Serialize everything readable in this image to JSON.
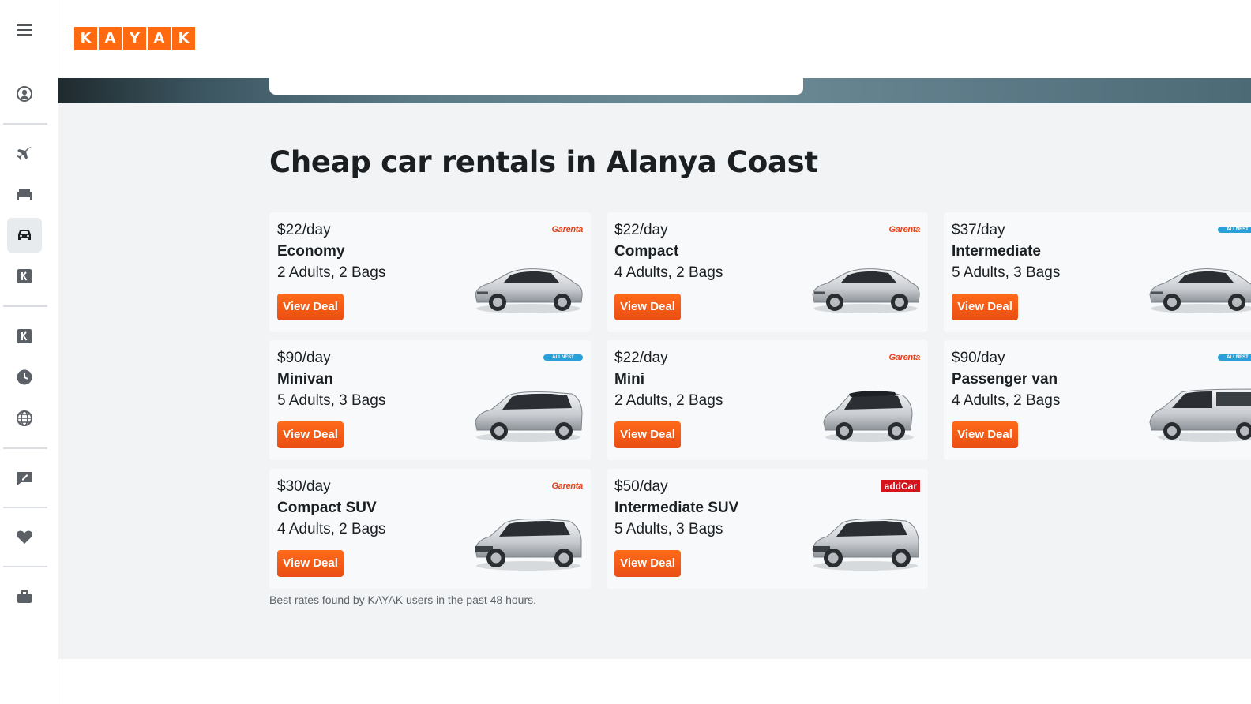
{
  "header": {
    "logo_letters": [
      "K",
      "A",
      "Y",
      "A",
      "K"
    ]
  },
  "sidebar": {
    "icons": [
      "menu-icon",
      "account-icon",
      "flights-icon",
      "stays-icon",
      "cars-icon",
      "packages-icon",
      "explore-icon",
      "trips-icon",
      "globe-icon",
      "feedback-icon",
      "heart-icon",
      "briefcase-icon"
    ]
  },
  "main": {
    "title": "Cheap car rentals in Alanya Coast",
    "deal_label": "View Deal",
    "footnote": "Best rates found by KAYAK users in the past 48 hours.",
    "cards": [
      {
        "price": "$22/day",
        "type": "Economy",
        "capacity": "2 Adults, 2 Bags",
        "brand": "Garenta",
        "car": "sedan"
      },
      {
        "price": "$22/day",
        "type": "Compact",
        "capacity": "4 Adults, 2 Bags",
        "brand": "Garenta",
        "car": "sedan"
      },
      {
        "price": "$37/day",
        "type": "Intermediate",
        "capacity": "5 Adults, 3 Bags",
        "brand": "ALLNEST",
        "car": "sedan"
      },
      {
        "price": "$90/day",
        "type": "Minivan",
        "capacity": "5 Adults, 3 Bags",
        "brand": "ALLNEST",
        "car": "minivan"
      },
      {
        "price": "$22/day",
        "type": "Mini",
        "capacity": "2 Adults, 2 Bags",
        "brand": "Garenta",
        "car": "mini"
      },
      {
        "price": "$90/day",
        "type": "Passenger van",
        "capacity": "4 Adults, 2 Bags",
        "brand": "ALLNEST",
        "car": "van"
      },
      {
        "price": "$30/day",
        "type": "Compact SUV",
        "capacity": "4 Adults, 2 Bags",
        "brand": "Garenta",
        "car": "suv"
      },
      {
        "price": "$50/day",
        "type": "Intermediate SUV",
        "capacity": "5 Adults, 3 Bags",
        "brand": "addCar",
        "car": "suv"
      }
    ]
  }
}
